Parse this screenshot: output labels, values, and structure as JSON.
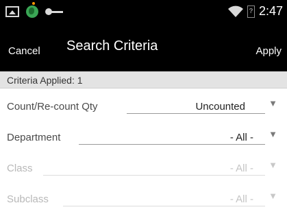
{
  "status_bar": {
    "icons": [
      "image-icon",
      "globe-notification-icon",
      "key-icon"
    ],
    "battery_text": "?",
    "time": "2:47"
  },
  "action_bar": {
    "cancel_label": "Cancel",
    "title": "Search Criteria",
    "apply_label": "Apply"
  },
  "criteria_applied": "Criteria Applied: 1",
  "fields": [
    {
      "label": "Count/Re-count Qty",
      "value": "Uncounted",
      "enabled": true
    },
    {
      "label": "Department",
      "value": "- All -",
      "enabled": true
    },
    {
      "label": "Class",
      "value": "- All -",
      "enabled": false
    },
    {
      "label": "Subclass",
      "value": "- All -",
      "enabled": false
    }
  ],
  "dropdown_glyph": "▼"
}
